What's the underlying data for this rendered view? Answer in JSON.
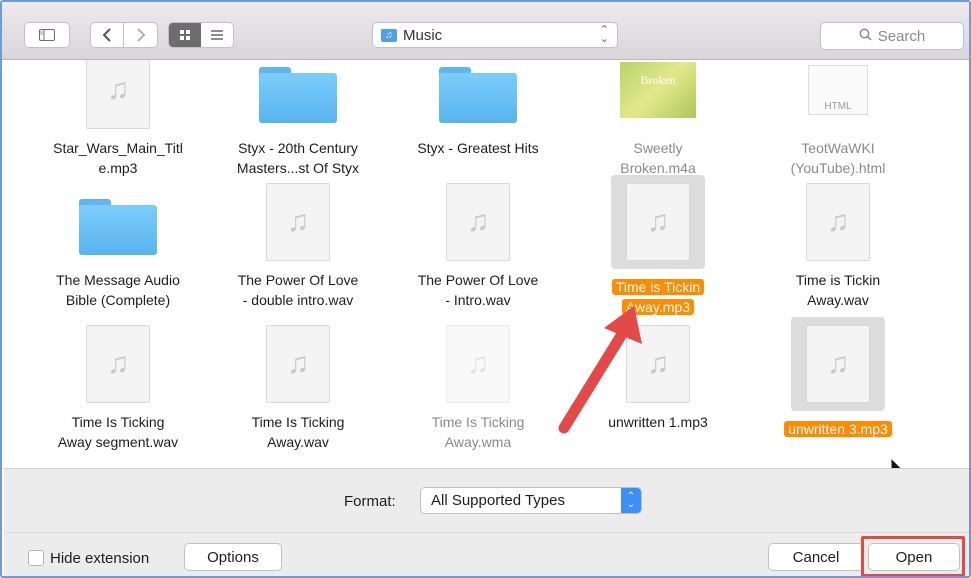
{
  "toolbar": {
    "location_label": "Music",
    "search_placeholder": "Search"
  },
  "files": [
    {
      "name_line1": "Star_Wars_Main_Titl",
      "name_line2": "e.mp3",
      "kind": "audio",
      "dim": false,
      "selected": false
    },
    {
      "name_line1": "Styx - 20th Century",
      "name_line2": "Masters...st Of Styx",
      "kind": "folder",
      "dim": false,
      "selected": false
    },
    {
      "name_line1": "Styx - Greatest Hits",
      "name_line2": "",
      "kind": "folder",
      "dim": false,
      "selected": false
    },
    {
      "name_line1": "Sweetly",
      "name_line2": "Broken.m4a",
      "kind": "album-art",
      "art_text": "Broken",
      "dim": true,
      "selected": false
    },
    {
      "name_line1": "TeotWaWKI",
      "name_line2": "(YouTube).html",
      "kind": "html",
      "badge": "HTML",
      "dim": true,
      "selected": false
    },
    {
      "name_line1": "The Message Audio",
      "name_line2": "Bible (Complete)",
      "kind": "folder",
      "dim": false,
      "selected": false
    },
    {
      "name_line1": "The Power Of Love",
      "name_line2": "- double intro.wav",
      "kind": "audio",
      "dim": false,
      "selected": false
    },
    {
      "name_line1": "The Power Of Love",
      "name_line2": "- Intro.wav",
      "kind": "audio",
      "dim": false,
      "selected": false
    },
    {
      "name_line1": "Time is Tickin",
      "name_line2": "Away.mp3",
      "kind": "audio",
      "dim": false,
      "selected": true
    },
    {
      "name_line1": "Time is Tickin",
      "name_line2": "Away.wav",
      "kind": "audio",
      "dim": false,
      "selected": false
    },
    {
      "name_line1": "Time Is Ticking",
      "name_line2": "Away segment.wav",
      "kind": "audio",
      "dim": false,
      "selected": false
    },
    {
      "name_line1": "Time Is Ticking",
      "name_line2": "Away.wav",
      "kind": "audio",
      "dim": false,
      "selected": false
    },
    {
      "name_line1": "Time Is Ticking",
      "name_line2": "Away.wma",
      "kind": "audio",
      "dim": true,
      "selected": false
    },
    {
      "name_line1": "unwritten 1.mp3",
      "name_line2": "",
      "kind": "audio",
      "dim": false,
      "selected": false
    },
    {
      "name_line1": "unwritten 3.mp3",
      "name_line2": "",
      "kind": "audio",
      "dim": false,
      "selected": true
    }
  ],
  "format": {
    "label": "Format:",
    "value": "All Supported Types"
  },
  "bottom": {
    "hide_extension_label": "Hide extension",
    "options_label": "Options",
    "cancel_label": "Cancel",
    "open_label": "Open"
  },
  "colors": {
    "selection": "#ff8c00",
    "highlight_box": "#e24a4a",
    "arrow": "#e24a4a",
    "accent": "#3e8ef7"
  }
}
